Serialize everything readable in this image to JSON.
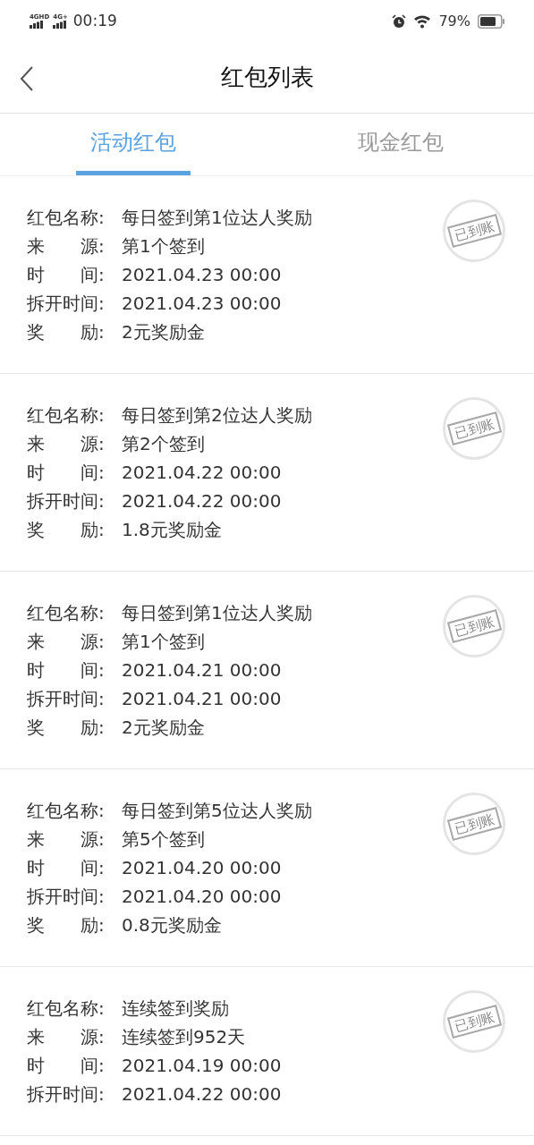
{
  "status_bar": {
    "network_1": "4GHD",
    "network_2": "4G+",
    "time": "00:19",
    "battery": "79%"
  },
  "header": {
    "title": "红包列表"
  },
  "tabs": [
    {
      "label": "活动红包",
      "selected": true
    },
    {
      "label": "现金红包",
      "selected": false
    }
  ],
  "items": [
    {
      "fields": [
        {
          "label": "红包名称:",
          "value": "每日签到第1位达人奖励"
        },
        {
          "label": "来　　源:",
          "value": "第1个签到"
        },
        {
          "label": "时　　间:",
          "value": "2021.04.23 00:00"
        },
        {
          "label": "拆开时间:",
          "value": "2021.04.23 00:00"
        },
        {
          "label": "奖　　励:",
          "value": "2元奖励金"
        }
      ],
      "stamp": "已到账"
    },
    {
      "fields": [
        {
          "label": "红包名称:",
          "value": "每日签到第2位达人奖励"
        },
        {
          "label": "来　　源:",
          "value": "第2个签到"
        },
        {
          "label": "时　　间:",
          "value": "2021.04.22 00:00"
        },
        {
          "label": "拆开时间:",
          "value": "2021.04.22 00:00"
        },
        {
          "label": "奖　　励:",
          "value": "1.8元奖励金"
        }
      ],
      "stamp": "已到账"
    },
    {
      "fields": [
        {
          "label": "红包名称:",
          "value": "每日签到第1位达人奖励"
        },
        {
          "label": "来　　源:",
          "value": "第1个签到"
        },
        {
          "label": "时　　间:",
          "value": "2021.04.21 00:00"
        },
        {
          "label": "拆开时间:",
          "value": "2021.04.21 00:00"
        },
        {
          "label": "奖　　励:",
          "value": "2元奖励金"
        }
      ],
      "stamp": "已到账"
    },
    {
      "fields": [
        {
          "label": "红包名称:",
          "value": "每日签到第5位达人奖励"
        },
        {
          "label": "来　　源:",
          "value": "第5个签到"
        },
        {
          "label": "时　　间:",
          "value": "2021.04.20 00:00"
        },
        {
          "label": "拆开时间:",
          "value": "2021.04.20 00:00"
        },
        {
          "label": "奖　　励:",
          "value": "0.8元奖励金"
        }
      ],
      "stamp": "已到账"
    },
    {
      "fields": [
        {
          "label": "红包名称:",
          "value": "连续签到奖励"
        },
        {
          "label": "来　　源:",
          "value": "连续签到952天"
        },
        {
          "label": "时　　间:",
          "value": "2021.04.19 00:00"
        },
        {
          "label": "拆开时间:",
          "value": "2021.04.22 00:00"
        }
      ],
      "stamp": "已到账"
    }
  ]
}
